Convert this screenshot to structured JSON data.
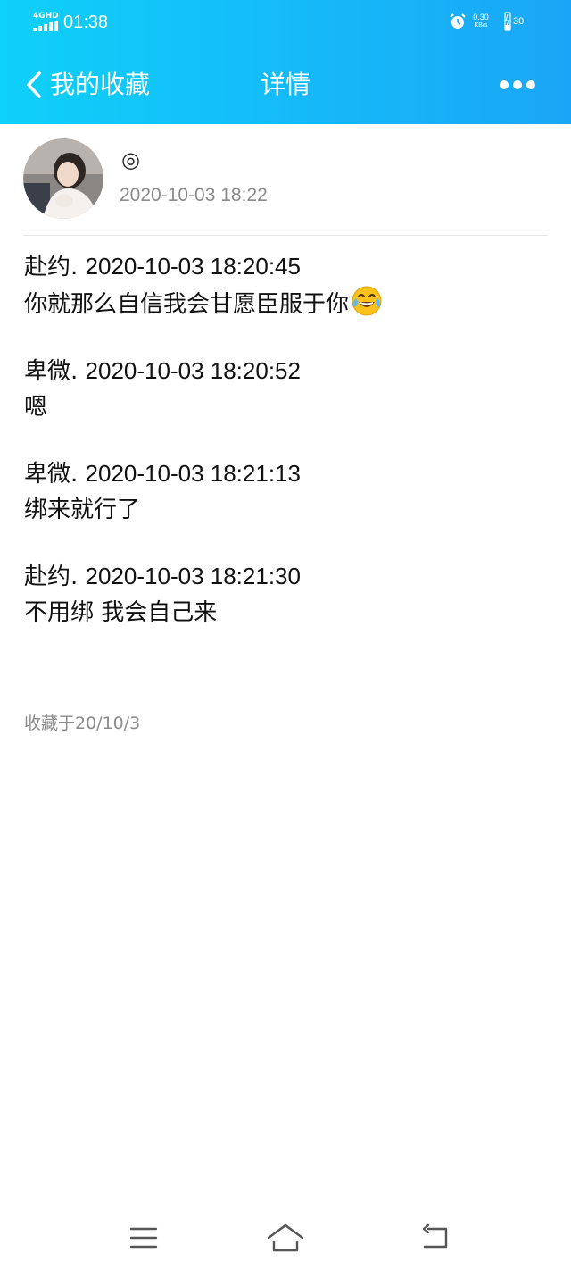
{
  "status_bar": {
    "network": "4GHD",
    "time": "01:38",
    "speed_value": "0.30",
    "speed_unit": "KB/s",
    "battery": "30",
    "icons": [
      "signal-icon",
      "alarm-icon",
      "battery-icon"
    ]
  },
  "header": {
    "back_label": "我的收藏",
    "title": "详情",
    "icons": [
      "chevron-left-icon",
      "more-icon"
    ],
    "color": "#1aa6f6"
  },
  "post": {
    "username": "◎",
    "date": "2020-10-03 18:22",
    "avatar": "avatar-photo"
  },
  "messages": [
    {
      "sender": "赴约.",
      "timestamp": "2020-10-03 18:20:45",
      "text": "你就那么自信我会甘愿臣服于你",
      "emoji": "tears-of-joy-emoji"
    },
    {
      "sender": "卑微.",
      "timestamp": "2020-10-03 18:20:52",
      "text": "嗯"
    },
    {
      "sender": "卑微.",
      "timestamp": "2020-10-03 18:21:13",
      "text": "绑来就行了"
    },
    {
      "sender": "赴约.",
      "timestamp": "2020-10-03 18:21:30",
      "text": "不用绑 我会自己来"
    }
  ],
  "footer": {
    "saved_label": "收藏于20/10/3"
  },
  "system_nav": {
    "icons": [
      "menu-icon",
      "home-icon",
      "back-icon"
    ]
  }
}
